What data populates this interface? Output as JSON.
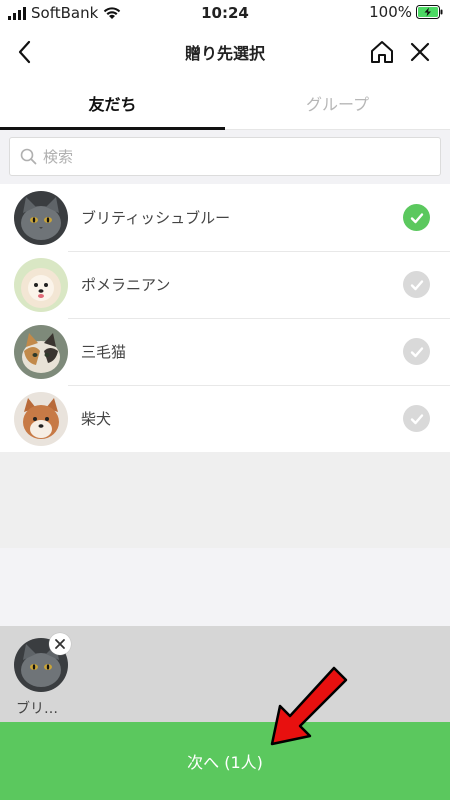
{
  "status": {
    "carrier": "SoftBank",
    "time": "10:24",
    "battery": "100%"
  },
  "nav": {
    "title": "贈り先選択",
    "back_icon": "chevron-left-icon",
    "home_icon": "home-icon",
    "close_icon": "close-icon"
  },
  "tabs": [
    {
      "label": "友だち",
      "active": true
    },
    {
      "label": "グループ",
      "active": false
    }
  ],
  "search": {
    "placeholder": "検索"
  },
  "friends": [
    {
      "name": "ブリティッシュブルー",
      "selected": true
    },
    {
      "name": "ポメラニアン",
      "selected": false
    },
    {
      "name": "三毛猫",
      "selected": false
    },
    {
      "name": "柴犬",
      "selected": false
    }
  ],
  "selected_bar": {
    "items": [
      {
        "name": "ブリ…"
      }
    ]
  },
  "next_button": {
    "label": "次へ (1人)"
  },
  "colors": {
    "accent": "#5bc85e",
    "check_inactive": "#d9d9d9",
    "arrow": "#e8100f"
  }
}
